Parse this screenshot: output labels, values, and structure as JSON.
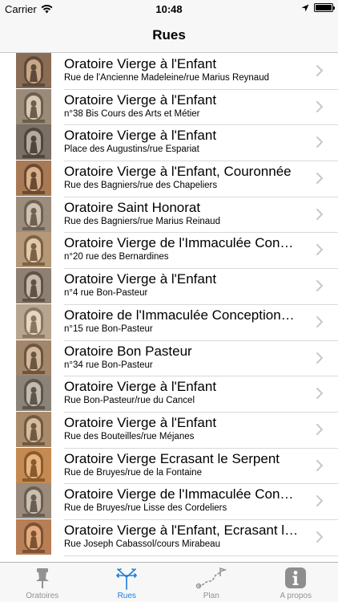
{
  "status_bar": {
    "carrier": "Carrier",
    "time": "10:48"
  },
  "nav": {
    "title": "Rues"
  },
  "rows": [
    {
      "title": "Oratoire Vierge à l'Enfant",
      "subtitle": "Rue de l'Ancienne Madeleine/rue Marius Reynaud"
    },
    {
      "title": "Oratoire Vierge à l'Enfant",
      "subtitle": "n°38 Bis Cours des Arts et Métier"
    },
    {
      "title": "Oratoire Vierge à l'Enfant",
      "subtitle": "Place des Augustins/rue Espariat"
    },
    {
      "title": "Oratoire Vierge à l'Enfant, Couronnée",
      "subtitle": "Rue des Bagniers/rue des Chapeliers"
    },
    {
      "title": "Oratoire Saint Honorat",
      "subtitle": "Rue des Bagniers/rue Marius Reinaud"
    },
    {
      "title": "Oratoire Vierge de l'Immaculée Con…",
      "subtitle": "n°20 rue des Bernardines"
    },
    {
      "title": "Oratoire Vierge à l'Enfant",
      "subtitle": "n°4 rue Bon-Pasteur"
    },
    {
      "title": "Oratoire de l'Immaculée Conception…",
      "subtitle": "n°15 rue Bon-Pasteur"
    },
    {
      "title": "Oratoire Bon Pasteur",
      "subtitle": "n°34 rue Bon-Pasteur"
    },
    {
      "title": "Oratoire Vierge à l'Enfant",
      "subtitle": "Rue Bon-Pasteur/rue du Cancel"
    },
    {
      "title": "Oratoire Vierge à l'Enfant",
      "subtitle": "Rue des Bouteilles/rue Méjanes"
    },
    {
      "title": "Oratoire Vierge Ecrasant le Serpent",
      "subtitle": "Rue de Bruyes/rue de la Fontaine"
    },
    {
      "title": "Oratoire Vierge de l'Immaculée Con…",
      "subtitle": "Rue de Bruyes/rue Lisse des Cordeliers"
    },
    {
      "title": "Oratoire Vierge à l'Enfant, Ecrasant l…",
      "subtitle": "Rue Joseph Cabassol/cours Mirabeau"
    }
  ],
  "tabs": [
    {
      "label": "Oratoires",
      "icon": "pin-icon",
      "active": false
    },
    {
      "label": "Rues",
      "icon": "crossroads-icon",
      "active": true
    },
    {
      "label": "Plan",
      "icon": "route-icon",
      "active": false
    },
    {
      "label": "A propos",
      "icon": "info-icon",
      "active": false
    }
  ],
  "colors": {
    "accent": "#1c7fe0",
    "inactive": "#929292",
    "separator": "#d9d9de"
  }
}
